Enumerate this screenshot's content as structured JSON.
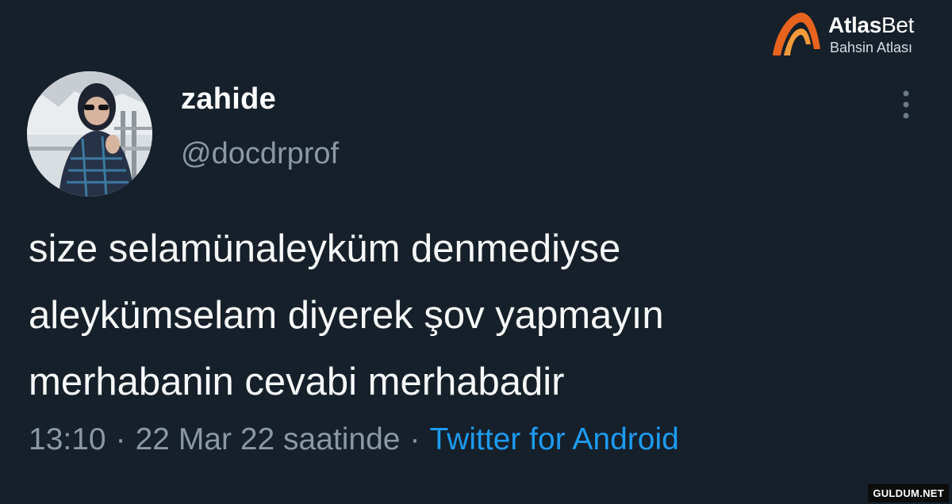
{
  "tweet": {
    "author": {
      "display_name": "zahide",
      "handle": "@docdrprof"
    },
    "text_lines": [
      "size selamünaleyküm denmediyse",
      "aleykümselam diyerek şov yapmayın",
      "merhabanin cevabi merhabadir"
    ],
    "meta": {
      "time": "13:10",
      "separator": "·",
      "date": "22 Mar 22 saatinde",
      "source": "Twitter for Android"
    }
  },
  "brand": {
    "name_bold": "Atlas",
    "name_light": "Bet",
    "tagline": "Bahsin Atlası",
    "accent": "#e8641e"
  },
  "watermark": "GULDUM.NET",
  "colors": {
    "background": "#15202b",
    "text": "#f7f9f9",
    "muted": "#8b98a5",
    "link": "#1d9bf0"
  },
  "icons": {
    "more": "more-vertical-icon",
    "logo": "atlasbet-arc-icon"
  }
}
